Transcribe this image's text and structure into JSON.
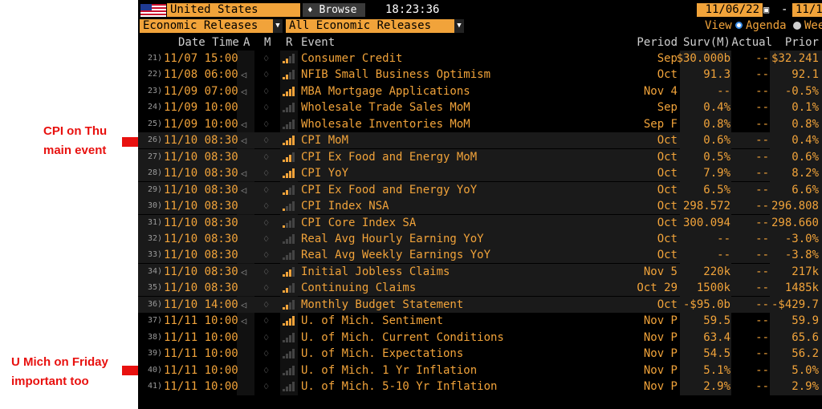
{
  "toolbar": {
    "country": "United States",
    "browse": "Browse",
    "time": "18:23:36",
    "start_date": "11/06/22",
    "range_sep": "-",
    "end_date": "11/1",
    "filter1": "Economic Releases",
    "filter2": "All Economic Releases",
    "view_label": "View",
    "view_agenda": "Agenda",
    "view_week": "Wee"
  },
  "columns": {
    "datetime": "Date Time",
    "a": "A",
    "m": "M",
    "r": "R",
    "event": "Event",
    "period": "Period",
    "survey": "Surv(M)",
    "actual": "Actual",
    "prior": "Prior"
  },
  "annotations": {
    "cpi_line1": "CPI on Thu",
    "cpi_line2": "main event",
    "umich_line1": "U Mich on Friday",
    "umich_line2": "important too"
  },
  "colors": {
    "accent": "#f1a33a",
    "annotation": "#e8110f",
    "background": "#000000"
  },
  "rows": [
    {
      "n": "21)",
      "dt": "11/07 15:00",
      "spk": false,
      "rel": 2,
      "ev": "Consumer Credit",
      "per": "Sep",
      "sv": "$30.000b",
      "act": "--",
      "pr": "$32.241"
    },
    {
      "n": "22)",
      "dt": "11/08 06:00",
      "spk": true,
      "rel": 2,
      "ev": "NFIB Small Business Optimism",
      "per": "Oct",
      "sv": "91.3",
      "act": "--",
      "pr": "92.1"
    },
    {
      "n": "23)",
      "dt": "11/09 07:00",
      "spk": true,
      "rel": 4,
      "ev": "MBA Mortgage Applications",
      "per": "Nov 4",
      "sv": "--",
      "act": "--",
      "pr": "-0.5%"
    },
    {
      "n": "24)",
      "dt": "11/09 10:00",
      "spk": false,
      "rel": 0,
      "ev": "Wholesale Trade Sales MoM",
      "per": "Sep",
      "sv": "0.4%",
      "act": "--",
      "pr": "0.1%"
    },
    {
      "n": "25)",
      "dt": "11/09 10:00",
      "spk": true,
      "rel": 0,
      "ev": "Wholesale Inventories MoM",
      "per": "Sep F",
      "sv": "0.8%",
      "act": "--",
      "pr": "0.8%"
    },
    {
      "n": "26)",
      "dt": "11/10 08:30",
      "spk": true,
      "rel": 4,
      "ev": "CPI MoM",
      "per": "Oct",
      "sv": "0.6%",
      "act": "--",
      "pr": "0.4%"
    },
    {
      "n": "27)",
      "dt": "11/10 08:30",
      "spk": false,
      "rel": 3,
      "ev": "CPI Ex Food and Energy MoM",
      "per": "Oct",
      "sv": "0.5%",
      "act": "--",
      "pr": "0.6%"
    },
    {
      "n": "28)",
      "dt": "11/10 08:30",
      "spk": true,
      "rel": 4,
      "ev": "CPI YoY",
      "per": "Oct",
      "sv": "7.9%",
      "act": "--",
      "pr": "8.2%"
    },
    {
      "n": "29)",
      "dt": "11/10 08:30",
      "spk": true,
      "rel": 2,
      "ev": "CPI Ex Food and Energy YoY",
      "per": "Oct",
      "sv": "6.5%",
      "act": "--",
      "pr": "6.6%"
    },
    {
      "n": "30)",
      "dt": "11/10 08:30",
      "spk": false,
      "rel": 1,
      "ev": "CPI Index NSA",
      "per": "Oct",
      "sv": "298.572",
      "act": "--",
      "pr": "296.808"
    },
    {
      "n": "31)",
      "dt": "11/10 08:30",
      "spk": false,
      "rel": 1,
      "ev": "CPI Core Index SA",
      "per": "Oct",
      "sv": "300.094",
      "act": "--",
      "pr": "298.660"
    },
    {
      "n": "32)",
      "dt": "11/10 08:30",
      "spk": false,
      "rel": 0,
      "ev": "Real Avg Hourly Earning YoY",
      "per": "Oct",
      "sv": "--",
      "act": "--",
      "pr": "-3.0%"
    },
    {
      "n": "33)",
      "dt": "11/10 08:30",
      "spk": false,
      "rel": 0,
      "ev": "Real Avg Weekly Earnings YoY",
      "per": "Oct",
      "sv": "--",
      "act": "--",
      "pr": "-3.8%"
    },
    {
      "n": "34)",
      "dt": "11/10 08:30",
      "spk": true,
      "rel": 3,
      "ev": "Initial Jobless Claims",
      "per": "Nov 5",
      "sv": "220k",
      "act": "--",
      "pr": "217k"
    },
    {
      "n": "35)",
      "dt": "11/10 08:30",
      "spk": false,
      "rel": 2,
      "ev": "Continuing Claims",
      "per": "Oct 29",
      "sv": "1500k",
      "act": "--",
      "pr": "1485k"
    },
    {
      "n": "36)",
      "dt": "11/10 14:00",
      "spk": true,
      "rel": 2,
      "ev": "Monthly Budget Statement",
      "per": "Oct",
      "sv": "-$95.0b",
      "act": "--",
      "pr": "-$429.7"
    },
    {
      "n": "37)",
      "dt": "11/11 10:00",
      "spk": true,
      "rel": 4,
      "ev": "U. of Mich. Sentiment",
      "per": "Nov P",
      "sv": "59.5",
      "act": "--",
      "pr": "59.9"
    },
    {
      "n": "38)",
      "dt": "11/11 10:00",
      "spk": false,
      "rel": 0,
      "ev": "U. of Mich. Current Conditions",
      "per": "Nov P",
      "sv": "63.4",
      "act": "--",
      "pr": "65.6"
    },
    {
      "n": "39)",
      "dt": "11/11 10:00",
      "spk": false,
      "rel": 0,
      "ev": "U. of Mich. Expectations",
      "per": "Nov P",
      "sv": "54.5",
      "act": "--",
      "pr": "56.2"
    },
    {
      "n": "40)",
      "dt": "11/11 10:00",
      "spk": false,
      "rel": 0,
      "ev": "U. of Mich. 1 Yr Inflation",
      "per": "Nov P",
      "sv": "5.1%",
      "act": "--",
      "pr": "5.0%"
    },
    {
      "n": "41)",
      "dt": "11/11 10:00",
      "spk": false,
      "rel": 0,
      "ev": "U. of Mich. 5-10 Yr Inflation",
      "per": "Nov P",
      "sv": "2.9%",
      "act": "--",
      "pr": "2.9%"
    }
  ]
}
